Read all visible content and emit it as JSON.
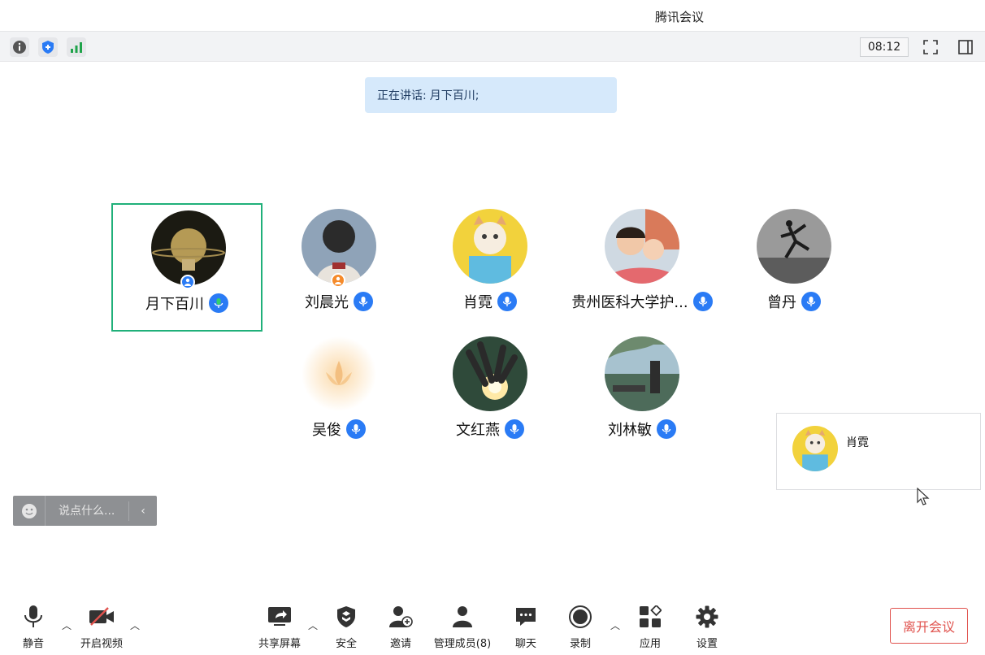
{
  "window": {
    "title": "腾讯会议"
  },
  "topbar": {
    "timer": "08:12"
  },
  "speaking": {
    "label": "正在讲话:",
    "name": "月下百川;"
  },
  "participants": [
    {
      "name": "月下百川",
      "active": true
    },
    {
      "name": "刘晨光"
    },
    {
      "name": "肖霓"
    },
    {
      "name": "贵州医科大学护..."
    },
    {
      "name": "曾丹"
    },
    {
      "name": "吴俊"
    },
    {
      "name": "文红燕"
    },
    {
      "name": "刘林敏"
    }
  ],
  "float_card": {
    "name": "肖霓"
  },
  "chat": {
    "placeholder": "说点什么..."
  },
  "toolbar": {
    "mute": "静音",
    "video": "开启视频",
    "share": "共享屏幕",
    "security": "安全",
    "invite": "邀请",
    "members": "管理成员(8)",
    "chat": "聊天",
    "record": "录制",
    "apps": "应用",
    "settings": "设置",
    "leave": "离开会议"
  },
  "colors": {
    "accent": "#2a7bf5",
    "active_border": "#20b07a",
    "leave": "#e0524d"
  }
}
